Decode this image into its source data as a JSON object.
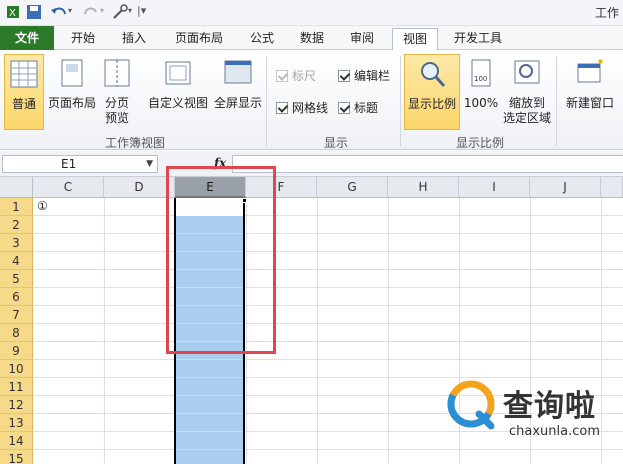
{
  "window": {
    "title": "工作"
  },
  "tabs": [
    "文件",
    "开始",
    "插入",
    "页面布局",
    "公式",
    "数据",
    "审阅",
    "视图",
    "开发工具"
  ],
  "ribbon": {
    "workbook_views": {
      "normal": "普通",
      "page_layout": "页面布局",
      "page_break_1": "分页",
      "page_break_2": "预览",
      "custom_views": "自定义视图",
      "full_screen": "全屏显示",
      "group_label": "工作簿视图"
    },
    "show": {
      "ruler": "标尺",
      "formula_bar": "编辑栏",
      "gridlines": "网格线",
      "headings": "标题",
      "group_label": "显示"
    },
    "zoom": {
      "zoom": "显示比例",
      "zoom_100": "100%",
      "zoom_sel_1": "缩放到",
      "zoom_sel_2": "选定区域",
      "group_label": "显示比例"
    },
    "window": {
      "new_window": "新建窗口"
    }
  },
  "formula_bar": {
    "name_box": "E1",
    "fx": "fx",
    "formula": ""
  },
  "sheet": {
    "columns": [
      "C",
      "D",
      "E",
      "F",
      "G",
      "H",
      "I",
      "J"
    ],
    "rows": [
      "1",
      "2",
      "3",
      "4",
      "5",
      "6",
      "7",
      "8",
      "9",
      "10",
      "11",
      "12",
      "13",
      "14",
      "15"
    ],
    "cell_c1": "①"
  },
  "watermark": {
    "name": "查询啦",
    "url": "chaxunla.com"
  },
  "colors": {
    "accent_file_tab": "#2a7a2a",
    "selection": "#a9cdee",
    "highlight": "#e0464f"
  }
}
